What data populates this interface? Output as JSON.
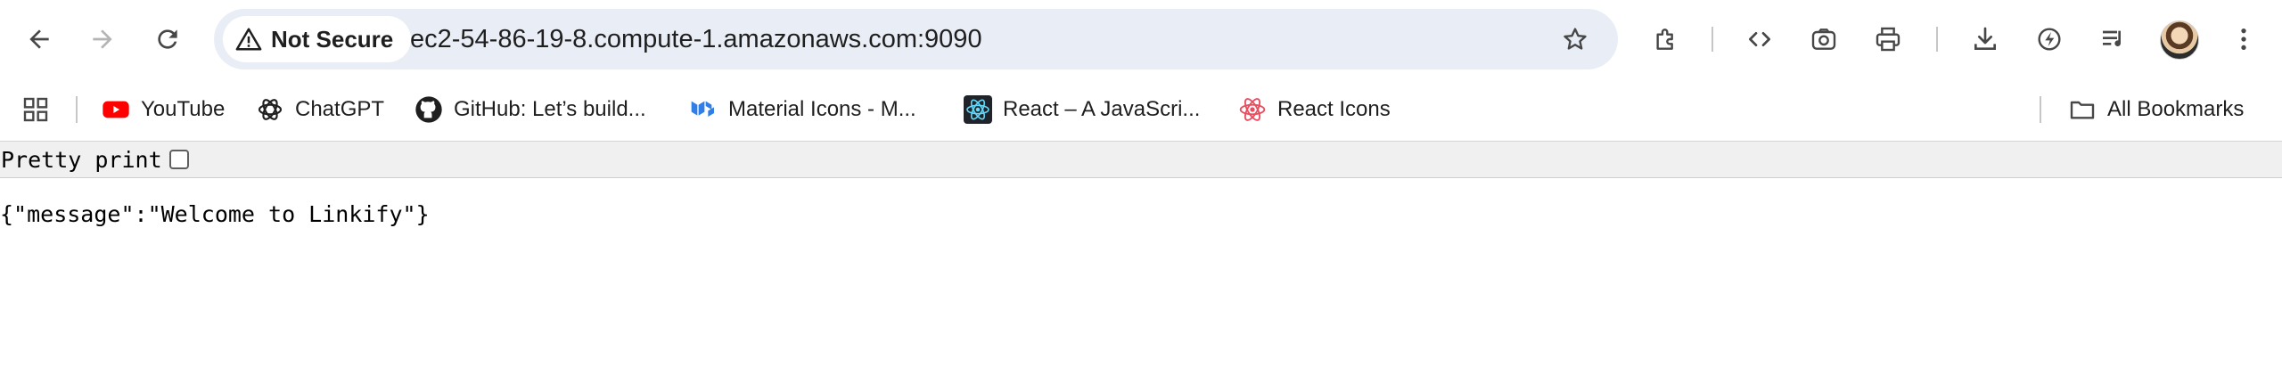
{
  "toolbar": {
    "back_icon": "back-arrow-icon",
    "forward_icon": "forward-arrow-icon",
    "reload_icon": "reload-icon",
    "security_label": "Not Secure",
    "url": "ec2-54-86-19-8.compute-1.amazonaws.com:9090",
    "bookmark_star_icon": "star-icon",
    "extension_icons": [
      "puzzle-icon",
      "code-icon",
      "screenshot-icon",
      "print-icon",
      "download-icon",
      "performance-icon",
      "media-queue-icon"
    ],
    "menu_icon": "kebab-menu-icon"
  },
  "bookmarks": {
    "apps_icon": "apps-grid-icon",
    "items": [
      {
        "label": "YouTube",
        "icon": "youtube-icon",
        "color": "#ff0000"
      },
      {
        "label": "ChatGPT",
        "icon": "chatgpt-icon",
        "color": "#1f1f1f"
      },
      {
        "label": "GitHub: Let’s build...",
        "icon": "github-icon",
        "color": "#1f1f1f"
      },
      {
        "label": "Material Icons - M...",
        "icon": "material-ui-icon",
        "color": "#2f7fe6"
      },
      {
        "label": "React – A JavaScri...",
        "icon": "react-icon",
        "color": "#61dafb"
      },
      {
        "label": "React Icons",
        "icon": "react-icons-icon",
        "color": "#e94d5f"
      }
    ],
    "all_bookmarks_label": "All Bookmarks"
  },
  "page": {
    "pretty_print_label": "Pretty print",
    "pretty_print_checked": false,
    "json_text": "{\"message\":\"Welcome to Linkify\"}"
  }
}
